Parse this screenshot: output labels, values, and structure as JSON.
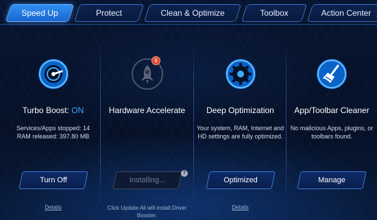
{
  "tabs": [
    {
      "label": "Speed Up",
      "active": true
    },
    {
      "label": "Protect",
      "active": false
    },
    {
      "label": "Clean & Optimize",
      "active": false
    },
    {
      "label": "Toolbox",
      "active": false
    },
    {
      "label": "Action Center",
      "active": false
    }
  ],
  "turbo": {
    "title": "Turbo Boost: ",
    "state": "ON",
    "line1": "Services/Apps stopped: 14",
    "line2": "RAM released: 397.80 MB",
    "button": "Turn Off",
    "link": "Details",
    "icon": "speedometer-icon"
  },
  "hardware": {
    "title": "Hardware Accelerate",
    "badge": "9",
    "button": "Installing...",
    "help": "?",
    "note": "Click Update All will install Driver Booster.",
    "icon": "rocket-icon"
  },
  "deep": {
    "title": "Deep Optimization",
    "desc": "Your system, RAM, Internet and HD settings are fully optimized.",
    "button": "Optimized",
    "link": "Details",
    "icon": "gear-icon"
  },
  "cleaner": {
    "title": "App/Toolbar Cleaner",
    "desc": "No malicious Apps, plugins, or toolbars found.",
    "button": "Manage",
    "icon": "broom-icon"
  },
  "colors": {
    "accent": "#2f8ff0",
    "on_state": "#3fa9ff",
    "background": "#061127"
  }
}
